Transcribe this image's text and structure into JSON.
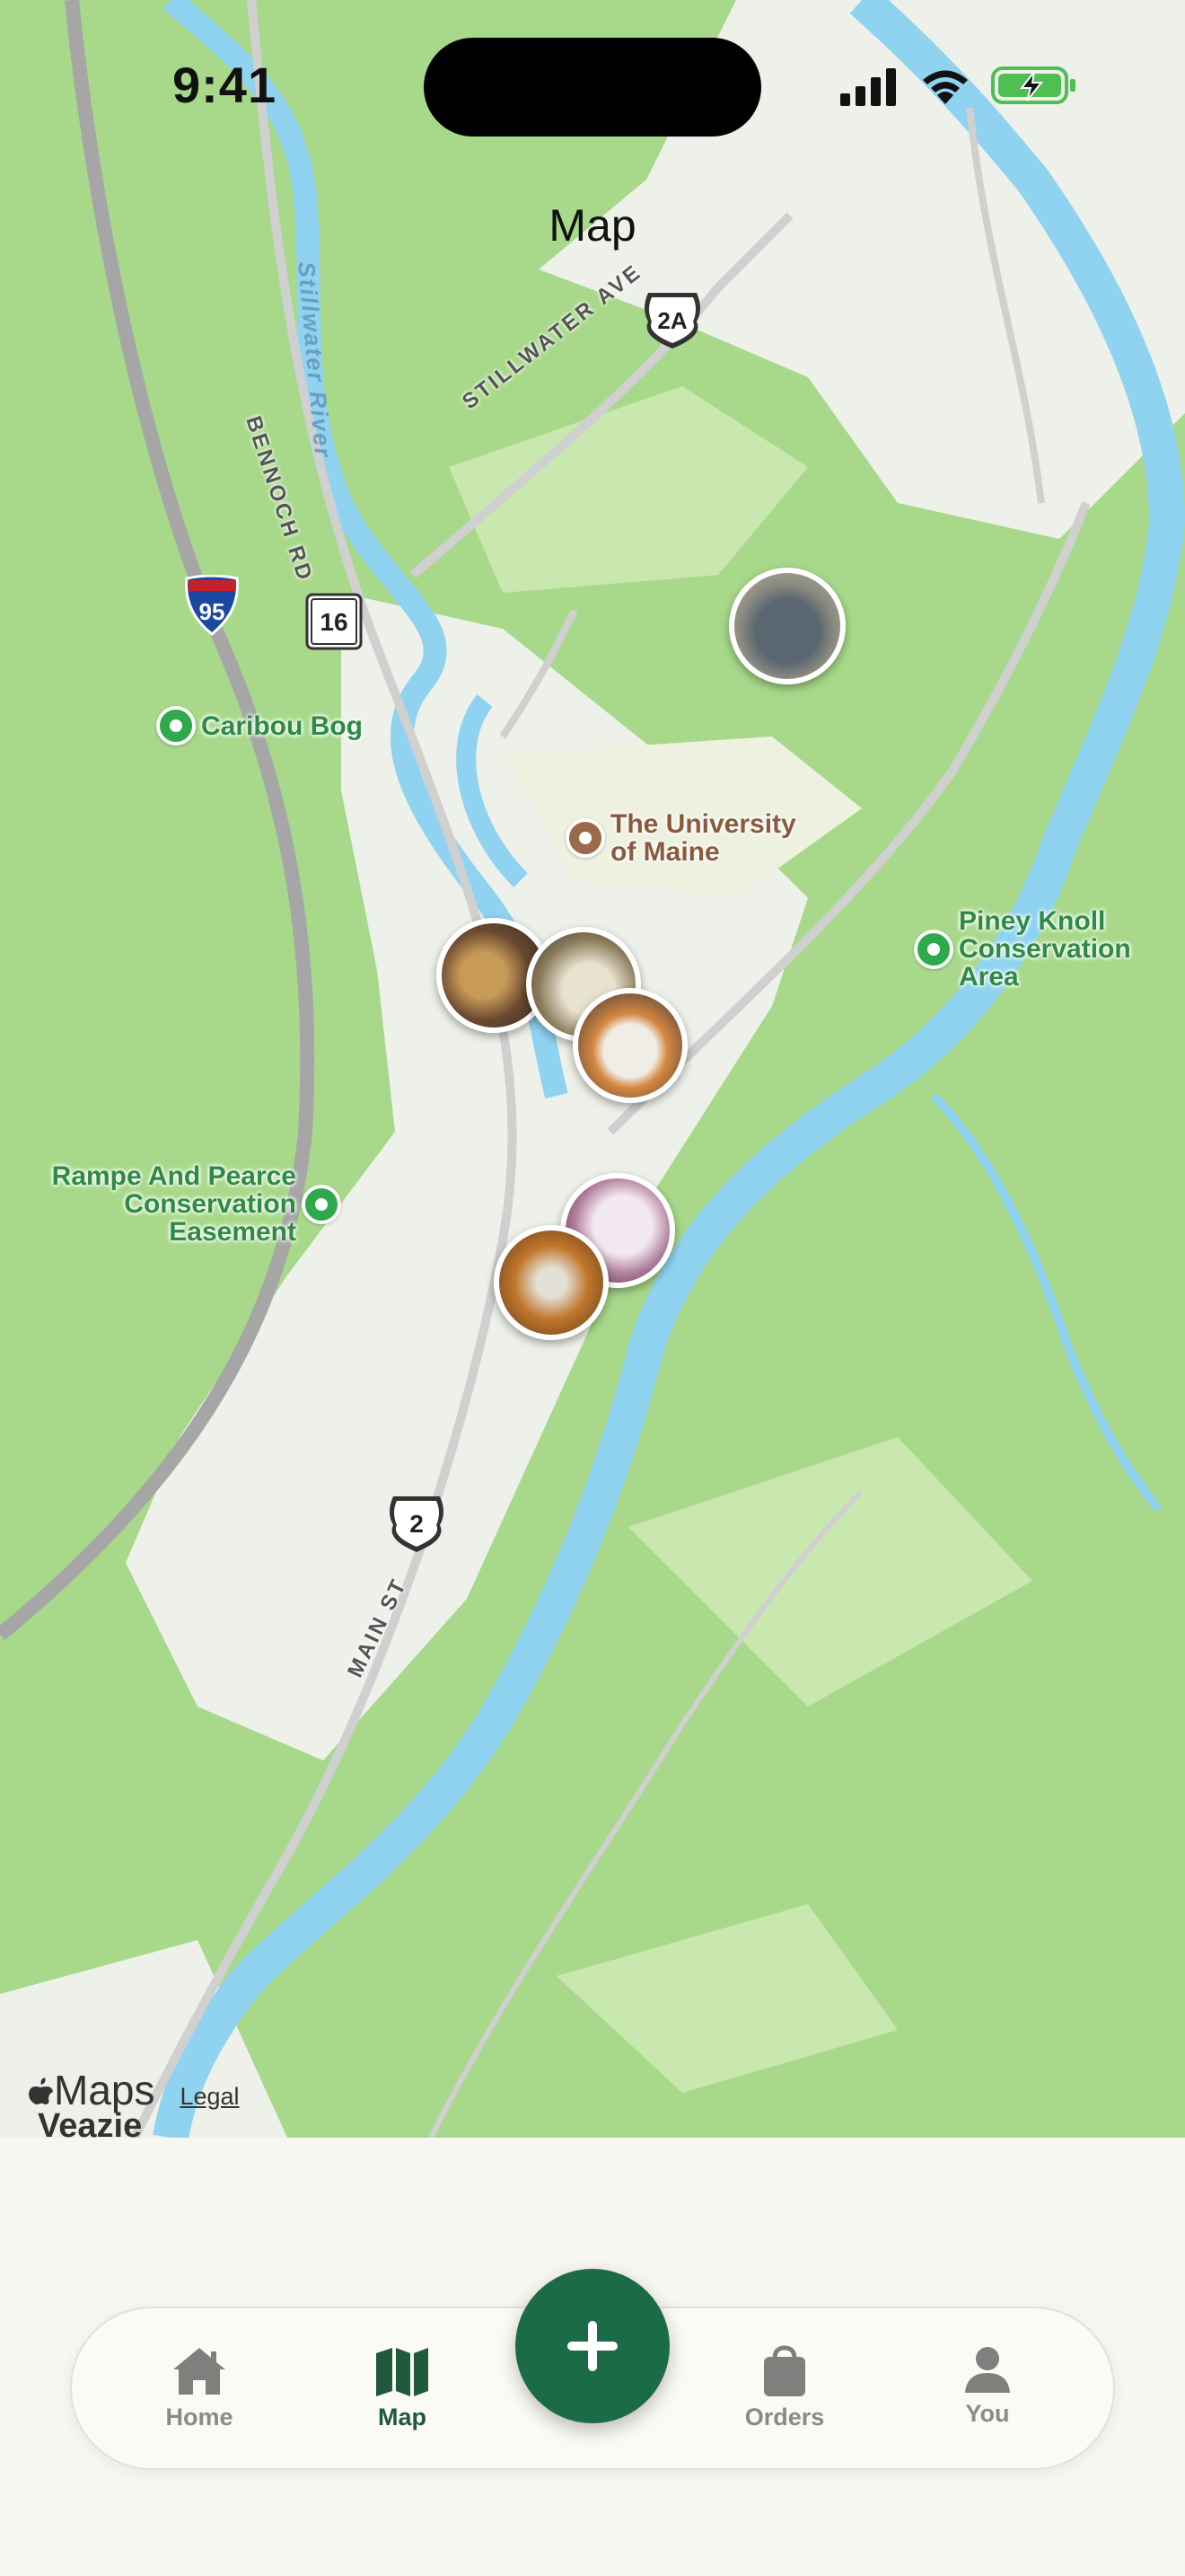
{
  "status_bar": {
    "time": "9:41"
  },
  "header": {
    "title": "Map"
  },
  "map": {
    "pois": [
      {
        "name": "Caribou Bog"
      },
      {
        "name": "The University of Maine"
      },
      {
        "name": "Piney Knoll Conservation Area"
      },
      {
        "name": "Rampe And Pearce Conservation Easement"
      }
    ],
    "roads": {
      "stillwater": "STILLWATER AVE",
      "bennoch": "BENNOCH RD",
      "main": "MAIN ST"
    },
    "river": "Stillwater River",
    "shields": {
      "i95": "95",
      "route16": "16",
      "us2a": "2A",
      "us2": "2"
    },
    "town_label": "Veazie",
    "attribution": {
      "brand": "Maps",
      "legal": "Legal"
    },
    "pin_count": 6
  },
  "tabbar": {
    "tabs": [
      {
        "label": "Home",
        "icon": "house-icon"
      },
      {
        "label": "Map",
        "icon": "map-icon",
        "active": true
      },
      {
        "label": "Orders",
        "icon": "bag-icon"
      },
      {
        "label": "You",
        "icon": "person-icon"
      }
    ],
    "fab_icon": "plus-icon"
  },
  "colors": {
    "land": "#a8d98a",
    "water": "#8fd3f0",
    "accent": "#1c6b47"
  }
}
